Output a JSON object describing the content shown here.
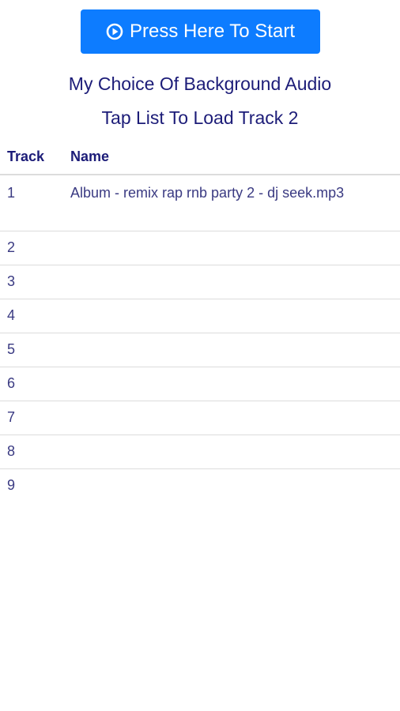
{
  "start_button": {
    "label": "Press Here To Start",
    "icon": "play-circle-icon",
    "color": "#0d7cff"
  },
  "headings": {
    "line1": "My Choice Of Background Audio",
    "line2": "Tap List To Load Track 2"
  },
  "table": {
    "columns": [
      "Track",
      "Name"
    ],
    "rows": [
      {
        "track": "1",
        "name": "Album - remix rap rnb party 2 - dj seek.mp3"
      },
      {
        "track": "2",
        "name": ""
      },
      {
        "track": "3",
        "name": ""
      },
      {
        "track": "4",
        "name": ""
      },
      {
        "track": "5",
        "name": ""
      },
      {
        "track": "6",
        "name": ""
      },
      {
        "track": "7",
        "name": ""
      },
      {
        "track": "8",
        "name": ""
      },
      {
        "track": "9",
        "name": ""
      }
    ]
  }
}
